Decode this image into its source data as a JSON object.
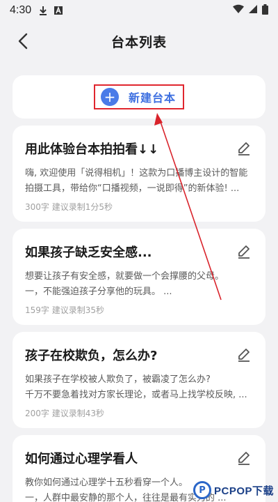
{
  "status_bar": {
    "time": "4:30",
    "icons": [
      "download-icon",
      "a-badge-icon",
      "wifi-icon",
      "signal-icon",
      "battery-icon"
    ]
  },
  "header": {
    "title": "台本列表",
    "back_icon": "chevron-left-icon"
  },
  "new_script": {
    "label": "新建台本",
    "icon": "plus-icon",
    "highlight_color": "#e0262e",
    "accent_color": "#3d6fe0"
  },
  "scripts": [
    {
      "title": "用此体验台本拍拍看↓↓",
      "preview_1": "嗨, 欢迎使用「说得相机」！这款为口播博主设计的智能",
      "preview_2": "拍摄工具，带给你“口播视频，一说即得”的新体验! ...",
      "meta": "300字  建议录制1分5秒"
    },
    {
      "title": "如果孩子缺乏安全感...",
      "preview_1": "想要让孩子有安全感，就要做一个会撑腰的父母。",
      "preview_2": "一，不能强迫孩子分享他的玩具。 ...",
      "meta": "159字  建议录制35秒"
    },
    {
      "title": "孩子在校欺负，怎么办?",
      "preview_1": "如果孩子在学校被人欺负了，被霸凌了怎么办?",
      "preview_2": "千万不要急着找对方家长理论，或者马上找学校反映, ...",
      "meta": "200字  建议录制43秒"
    },
    {
      "title": "如何通过心理学看人",
      "preview_1": "教你如何通过心理学十五秒看穿一个人。",
      "preview_2": "一，人群中最安静的那个人，往往是最有实力的 ...",
      "meta": ""
    }
  ],
  "watermark": {
    "logo_letter": "P",
    "text": "PCPOP下载"
  }
}
